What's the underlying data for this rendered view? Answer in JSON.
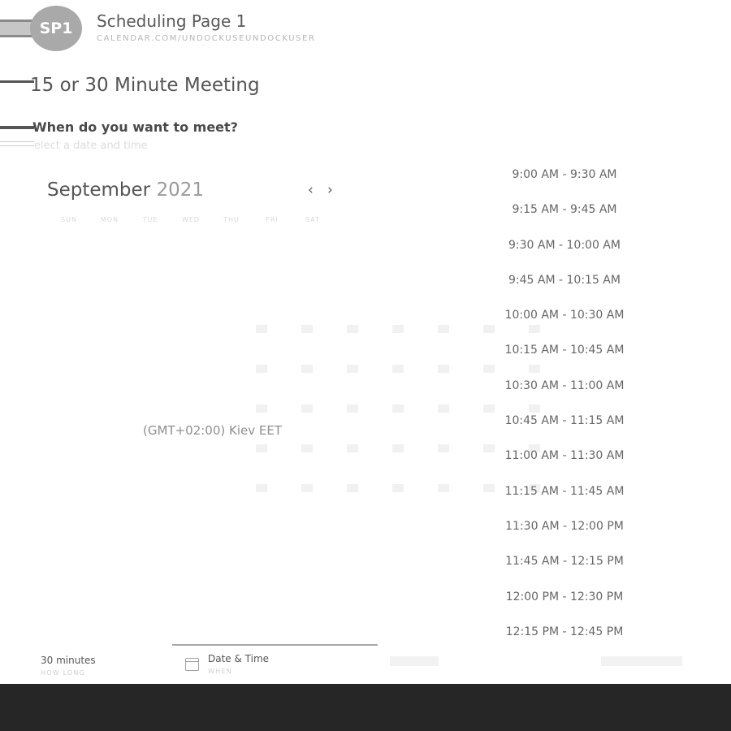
{
  "header": {
    "avatar_initials": "SP1",
    "title": "Scheduling Page 1",
    "url": "CALENDAR.COM/UNDOCKUSEUNDOCKUSER"
  },
  "meeting": {
    "title": "15 or 30 Minute Meeting",
    "question": "When do you want to meet?",
    "hint": "elect a date and time"
  },
  "calendar": {
    "month": "September",
    "year": "2021",
    "prev_icon": "‹",
    "next_icon": "›",
    "weekdays": [
      "SUN",
      "MON",
      "TUE",
      "WED",
      "THU",
      "FRI",
      "SAT"
    ]
  },
  "timezone": "(GMT+02:00) Kiev  EET",
  "time_slots": [
    "9:00 AM - 9:30 AM",
    "9:15 AM - 9:45 AM",
    "9:30 AM - 10:00 AM",
    "9:45 AM - 10:15 AM",
    "10:00 AM - 10:30 AM",
    "10:15 AM - 10:45 AM",
    "10:30 AM - 11:00 AM",
    "10:45 AM - 11:15 AM",
    "11:00 AM - 11:30 AM",
    "11:15 AM - 11:45 AM",
    "11:30 AM - 12:00 PM",
    "11:45 AM - 12:15 PM",
    "12:00 PM - 12:30 PM",
    "12:15 PM - 12:45 PM"
  ],
  "footer": {
    "duration": "30 minutes",
    "duration_sub": "HOW LONG",
    "step_label": "Date & Time",
    "step_sub": "WHEN",
    "step_icon": "calendar-icon"
  }
}
